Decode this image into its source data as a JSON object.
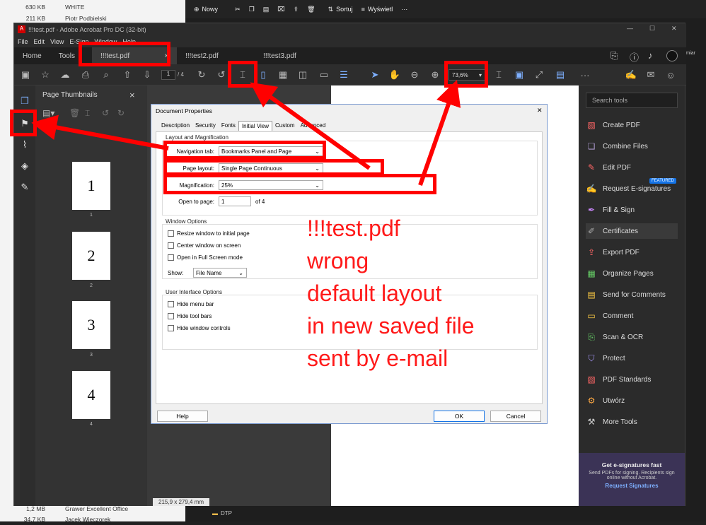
{
  "explorer_files": [
    {
      "size": "630 KB",
      "name": "WHITE"
    },
    {
      "size": "211 KB",
      "name": "Piotr Podbielski"
    },
    {
      "size": "1,2 MB",
      "name": "Grawer Excellent Office"
    },
    {
      "size": "34,7 KB",
      "name": "Jacek Wieczorek"
    }
  ],
  "explorer_toolbar": {
    "new": "Nowy",
    "sort": "Sortuj",
    "view": "Wyświetl",
    "more": "···"
  },
  "explorer_folder": "DTP",
  "user_fragment": "ozmiar",
  "window": {
    "title": "!!!test.pdf - Adobe Acrobat Pro DC (32-bit)"
  },
  "menu": [
    "File",
    "Edit",
    "View",
    "E-Sign",
    "Window",
    "Help"
  ],
  "tabs": {
    "home": "Home",
    "tools": "Tools",
    "docs": [
      "!!!test.pdf",
      "!!!test2.pdf",
      "!!!test3.pdf"
    ],
    "close": "×"
  },
  "toolbar": {
    "page_num": "1",
    "page_total": "/ 4",
    "zoom": "73,6%"
  },
  "thumbs_panel": {
    "title": "Page Thumbnails",
    "close": "×",
    "pages": [
      "1",
      "2",
      "3",
      "4"
    ]
  },
  "tools_panel": {
    "search": "Search tools",
    "items": [
      "Create PDF",
      "Combine Files",
      "Edit PDF",
      "Request E-signatures",
      "Fill & Sign",
      "Certificates",
      "Export PDF",
      "Organize Pages",
      "Send for Comments",
      "Comment",
      "Scan & OCR",
      "Protect",
      "PDF Standards",
      "Utwórz",
      "More Tools"
    ],
    "featured": "FEATURED",
    "promo_title": "Get e-signatures fast",
    "promo_text": "Send PDFs for signing. Recipients sign online without Acrobat.",
    "promo_link": "Request Signatures"
  },
  "dialog": {
    "title": "Document Properties",
    "close": "✕",
    "tabs": [
      "Description",
      "Security",
      "Fonts",
      "Initial View",
      "Custom",
      "Advanced"
    ],
    "group1": "Layout and Magnification",
    "nav_label": "Navigation tab:",
    "nav_value": "Bookmarks Panel and Page",
    "layout_label": "Page layout:",
    "layout_value": "Single Page Continuous",
    "mag_label": "Magnification:",
    "mag_value": "25%",
    "open_label": "Open to page:",
    "open_value": "1",
    "open_of": "of 4",
    "group2": "Window Options",
    "win_opts": [
      "Resize window to initial page",
      "Center window on screen",
      "Open in Full Screen mode"
    ],
    "show_label": "Show:",
    "show_value": "File Name",
    "group3": "User Interface Options",
    "ui_opts": [
      "Hide menu bar",
      "Hide tool bars",
      "Hide window controls"
    ],
    "help": "Help",
    "ok": "OK",
    "cancel": "Cancel"
  },
  "annotation": [
    "!!!test.pdf",
    "wrong",
    "default layout",
    "in new saved file",
    "sent by e-mail"
  ],
  "status": "215,9 x 279,4 mm",
  "colors": {
    "annotation": "#ff0000",
    "accent": "#1473e6"
  }
}
